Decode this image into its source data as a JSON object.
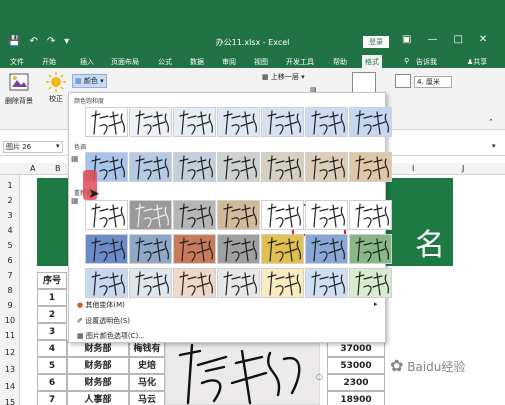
{
  "title_bar": {
    "doc_title": "办公11.xlsx - Excel",
    "login_label": "登录",
    "qat_icons": [
      "save-icon",
      "undo-icon",
      "redo-icon",
      "customize-icon"
    ],
    "window_icons": [
      "ribbon-display-icon",
      "minimize-icon",
      "restore-icon",
      "close-icon"
    ]
  },
  "ribbon_tabs": [
    "文件",
    "开始",
    "插入",
    "页面布局",
    "公式",
    "数据",
    "审阅",
    "视图",
    "开发工具",
    "帮助",
    "格式"
  ],
  "ribbon_tab_active": "格式",
  "tell_me": "告诉我",
  "share": "共享",
  "ribbon": {
    "remove_bg": "删除背景",
    "correct": "校正",
    "color": "颜色",
    "bring_forward": "上移一层",
    "height_value": "4. 厘米"
  },
  "name_box": "图片 26",
  "columns": [
    "A",
    "B",
    "C",
    "D",
    "E",
    "F",
    "G",
    "H",
    "I",
    "J"
  ],
  "rows": [
    "1",
    "2",
    "3",
    "4",
    "5",
    "6",
    "7",
    "8",
    "9",
    "10",
    "11",
    "12",
    "13",
    "14",
    "15"
  ],
  "banner_char": "名",
  "table": {
    "col_seq": "序号",
    "rows": [
      {
        "no": "1",
        "dept": "",
        "name": "",
        "val": ""
      },
      {
        "no": "2",
        "dept": "",
        "name": "",
        "val": ""
      },
      {
        "no": "3",
        "dept": "",
        "name": "",
        "val": ""
      },
      {
        "no": "4",
        "dept": "财务部",
        "name": "梅钱有",
        "val": "37000"
      },
      {
        "no": "5",
        "dept": "财务部",
        "name": "史培",
        "val": "53000"
      },
      {
        "no": "6",
        "dept": "财务部",
        "name": "马化",
        "val": "2300"
      },
      {
        "no": "7",
        "dept": "人事部",
        "name": "马云",
        "val": "18900"
      }
    ]
  },
  "color_menu": {
    "section_saturation": "颜色饱和度",
    "section_tone": "色调",
    "section_recolor": "重新着色",
    "sig_text": "唐娜",
    "saturation_tints": [
      "#ffffff",
      "#eef2f6",
      "#e7edf5",
      "#dfe8f3",
      "#d6e2f2",
      "#cddcf2",
      "#c4d6f2"
    ],
    "tone_tints": [
      "#a8c4ea",
      "#b6cbe3",
      "#c3d0dc",
      "#cdd1cf",
      "#d6d0c3",
      "#dccdb6",
      "#e0c6a6"
    ],
    "recolor_row1": [
      "#ffffff",
      "#9a9a9a",
      "#b6b6b6",
      "#d2b99a",
      "#ffffff",
      "#ffffff",
      "#ffffff"
    ],
    "recolor_row2": [
      "#6a8cc8",
      "#8fa8c8",
      "#c87a5a",
      "#a0a0a0",
      "#e1c050",
      "#88a8d8",
      "#88b888"
    ],
    "recolor_row3": [
      "#c8d8ee",
      "#e0e6ee",
      "#f0d8c8",
      "#e8e8e8",
      "#f8ecc0",
      "#d0e0f4",
      "#d8ecd0"
    ],
    "more_variants": "其他变体(M)",
    "set_transparent": "设置透明色(S)",
    "picture_color_options": "图片颜色选项(C)..."
  },
  "watermark": "Baidu经验"
}
